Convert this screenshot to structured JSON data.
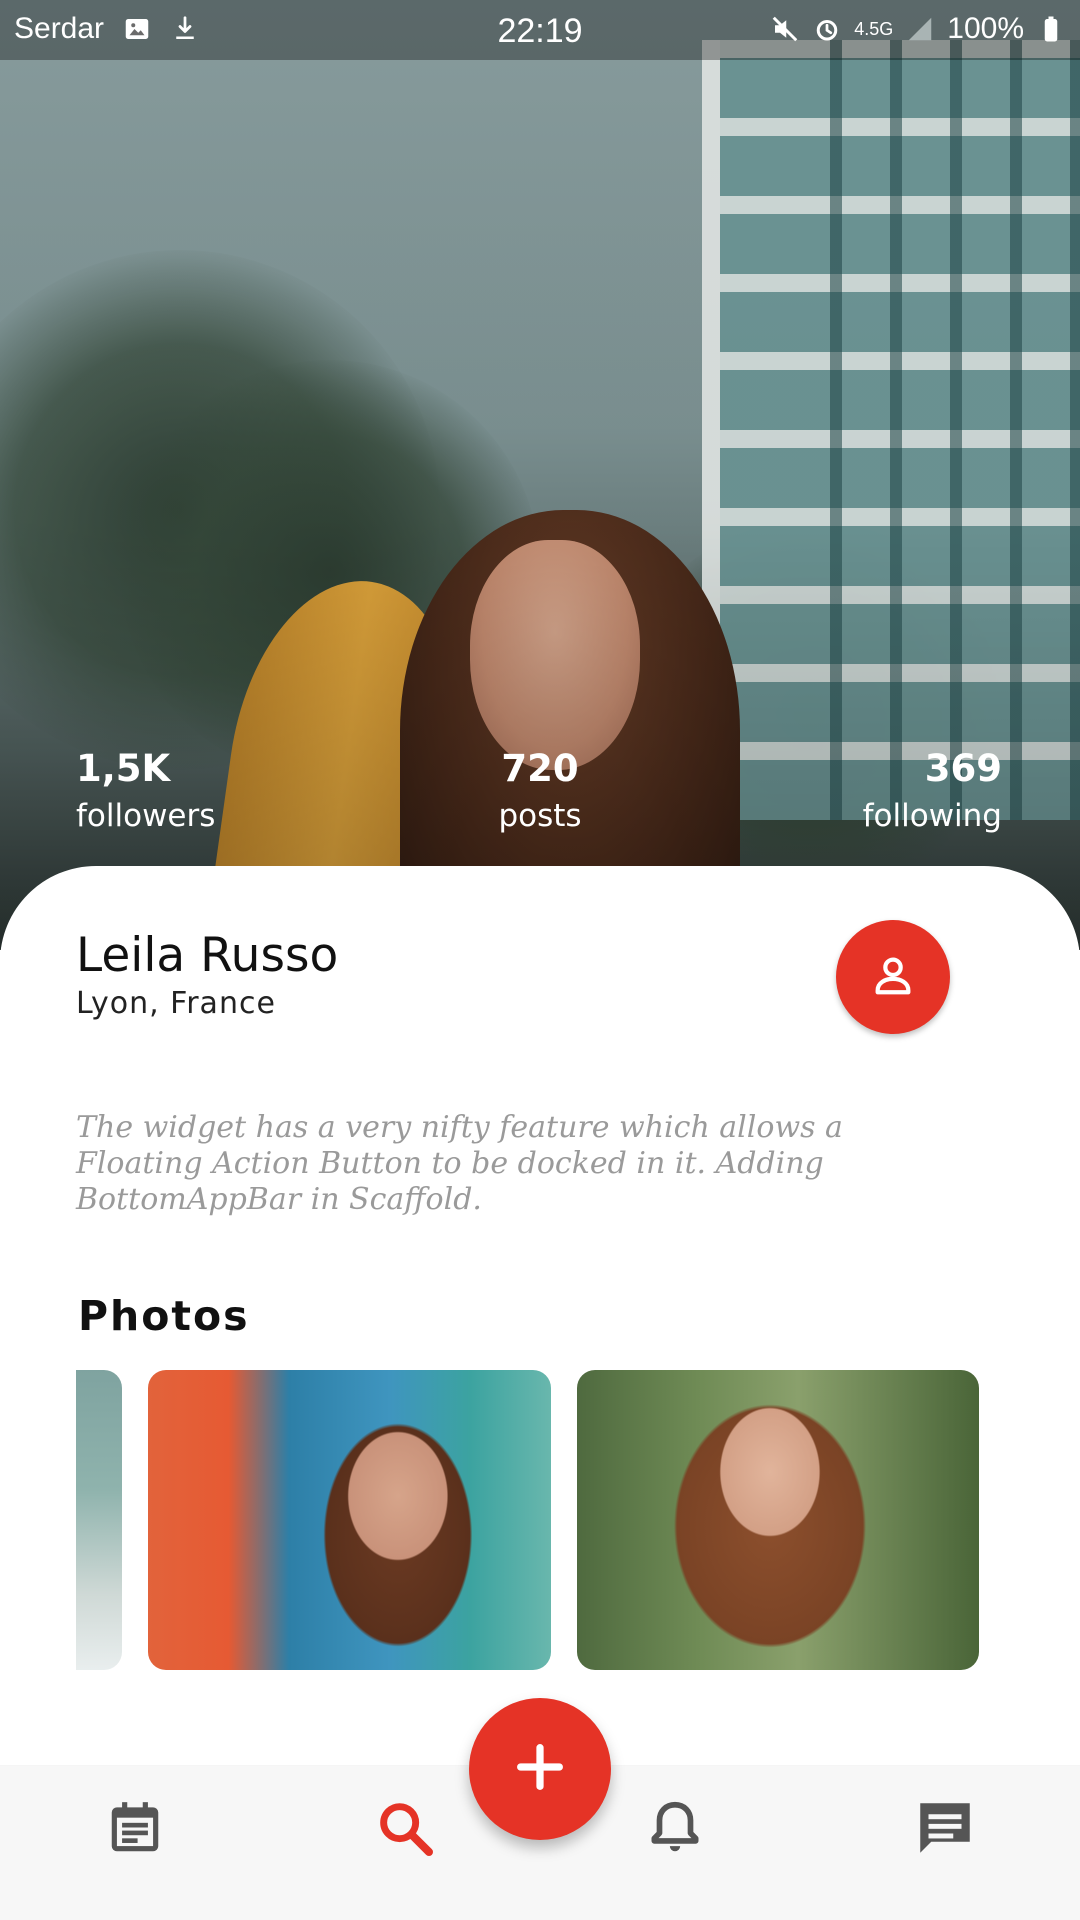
{
  "status_bar": {
    "carrier": "Serdar",
    "time": "22:19",
    "network": "4.5G",
    "battery": "100%"
  },
  "profile": {
    "stats": [
      {
        "value": "1,5K",
        "label": "followers"
      },
      {
        "value": "720",
        "label": "posts"
      },
      {
        "value": "369",
        "label": "following"
      }
    ],
    "name": "Leila Russo",
    "location": "Lyon, France",
    "bio": "The widget has a very nifty feature which allows a Floating Action Button to be docked in it. Adding BottomAppBar in Scaffold."
  },
  "photos": {
    "title": "Photos"
  },
  "bottom_nav": {
    "items": [
      "calendar-note-icon",
      "search-icon",
      "bell-icon",
      "chat-icon"
    ],
    "active": "search-icon"
  },
  "colors": {
    "accent": "#e53326",
    "nav_icon": "#555555"
  },
  "icons": {
    "profile_button": "person-icon",
    "fab": "plus-icon"
  }
}
